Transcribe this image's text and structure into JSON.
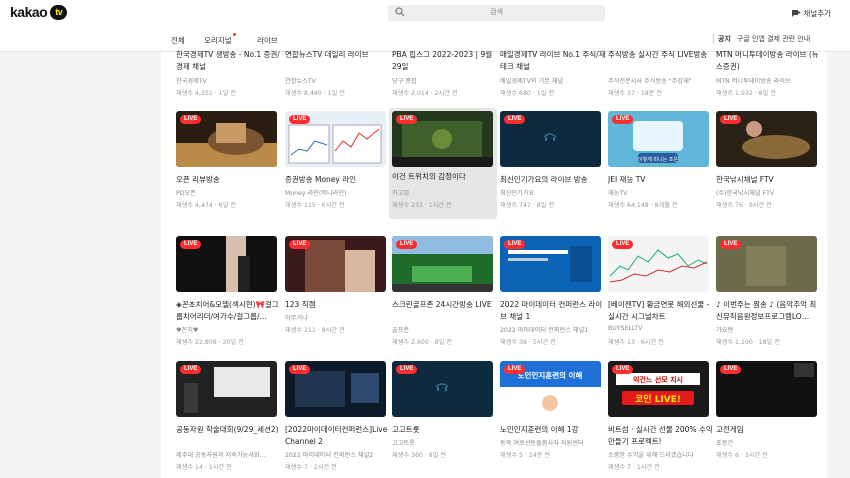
{
  "brand": {
    "name": "kakao",
    "tv": "tv"
  },
  "search": {
    "placeholder": "검색"
  },
  "add_channel": "채널추가",
  "tabs": [
    {
      "label": "전체",
      "dot": false
    },
    {
      "label": "오리지널",
      "dot": true
    },
    {
      "label": "라이브",
      "dot": false
    }
  ],
  "notice": {
    "tag": "공지",
    "text": "구글 인앱 결제 관련 안내"
  },
  "live_badge": "LIVE",
  "top_row": [
    {
      "title": "한국경제TV 생방송 - No.1 증권/경제 채널",
      "channel": "한국경제TV",
      "stats": "재생수 4,351 · 1일 전"
    },
    {
      "title": "연합뉴스TV 데일리 라이브",
      "channel": "연합뉴스TV",
      "stats": "재생수 8,440 · 1일 전"
    },
    {
      "title": "PBA 립스그 2022-2023 | 9월 29일",
      "channel": "당구 종합",
      "stats": "재생수 2,014 · 2시간 전"
    },
    {
      "title": "매일경제TV 라이브 No.1 주식/재테크 채널",
      "channel": "매일경제TV의 기본 채널",
      "stats": "재생수 680 · 1일 전"
    },
    {
      "title": "주식방송 실시간 주식 LIVE방송",
      "channel": "주식전문시사 주식방송 \"주강재\"",
      "stats": "재생수 37 · 18분 전"
    },
    {
      "title": "MTN 머니투데이방송 라이브 (뉴스증권)",
      "channel": "MTN 머니투데이방송 라이브",
      "stats": "재생수 1,932 · 8일 전"
    }
  ],
  "cards": [
    {
      "title": "오픈 리뷰방송",
      "channel": "PD오픈",
      "stats": "재생수 4,474 · 6일 전",
      "thumb": "desert",
      "hover": false
    },
    {
      "title": "증권방송 Money 라인",
      "channel": "Money 라인(머니라인)",
      "stats": "재생수 115 · 6시간 전",
      "thumb": "stocks",
      "hover": false
    },
    {
      "title": "이건 트위치의 감정이다",
      "channel": "카고임",
      "stats": "재생수 233 · 1시간 전",
      "thumb": "game",
      "hover": true
    },
    {
      "title": "최신인기가요의 라이브 방송",
      "channel": "최신인기가요",
      "stats": "재생수 747 · 8일 전",
      "thumb": "navy",
      "hover": false
    },
    {
      "title": "JEI 재능 TV",
      "channel": "재능TV",
      "stats": "재생수 64,148 · 8개월 전",
      "thumb": "kids",
      "hover": false
    },
    {
      "title": "한국낚시채널 FTV",
      "channel": "(주)한국낚시채널 FTV",
      "stats": "재생수 76 · 9시간 전",
      "thumb": "fish",
      "hover": false
    },
    {
      "title": "◈꼰초치어&모델(섹시현)🎀걸그룹치어리더/여가수/걸그룹/…",
      "channel": "♥꼰치♥",
      "stats": "재생수 22,808 · 20일 전",
      "thumb": "dance1",
      "hover": false
    },
    {
      "title": "123 직캠",
      "channel": "아무거나",
      "stats": "재생수 211 · 8시간 전",
      "thumb": "dance2",
      "hover": false
    },
    {
      "title": "스크린골프존 24시간방송 LIVE",
      "channel": "골프존",
      "stats": "재생수 2,600 · 8일 전",
      "thumb": "golf",
      "hover": false
    },
    {
      "title": "2022 마이데이터 컨퍼런스 라이브 채널 1",
      "channel": "2022 마이데이터 컨퍼런스 채널1",
      "stats": "재생수 38 · 5시간 전",
      "thumb": "conf",
      "hover": false
    },
    {
      "title": "[베이젠TV] 황금연못 해외선물 - 실시간 시그널차트",
      "channel": "BUYSELLTV",
      "stats": "재생수 13 · 6시간 전",
      "thumb": "chart",
      "hover": false
    },
    {
      "title": "♪ 이번주는 짬송 ♪ (음악추억 최신뮤직음원정보프로그램LO…",
      "channel": "가요랜",
      "stats": "재생수 1,100 · 18일 전",
      "thumb": "greenish",
      "hover": false
    },
    {
      "title": "공동자원 학술대회(9/29_세션2)",
      "channel": "제주대 공동자원과 지속가능사회…",
      "stats": "재생수 14 · 1시간 전",
      "thumb": "seminar",
      "hover": false
    },
    {
      "title": "[2022마이데이터컨퍼런스]Live Channel 2",
      "channel": "2022 마이데이터 컨퍼런스 채널2",
      "stats": "재생수 7 · 2시간 전",
      "thumb": "conf2",
      "hover": false
    },
    {
      "title": "고고트롯",
      "channel": "고고트롯",
      "stats": "재생수 360 · 8일 전",
      "thumb": "navy",
      "hover": false
    },
    {
      "title": "노인인지훈련의 이해 1강",
      "channel": "동북 여로선동돌봄사자 지원센터",
      "stats": "재생수 5 · 24분 전",
      "thumb": "elder",
      "hover": false
    },
    {
      "title": "비트섬 · 실시간 선물 200% 수익 만들기 프로젝트!",
      "channel": "소중한 수익을 위해 드리겠습니다",
      "stats": "재생수 7 · 1시간 전",
      "thumb": "coin",
      "hover": false
    },
    {
      "title": "고전게임",
      "channel": "포봉건",
      "stats": "재생수 6 · 3시간 전",
      "thumb": "dark",
      "hover": false
    }
  ],
  "thumb_text": {
    "elder": "노인인지훈련의 이해",
    "coin_top": "익건느 선모 지시",
    "coin_main": "코인 LIVE!",
    "kids": "이렇게 미니는 조은"
  }
}
